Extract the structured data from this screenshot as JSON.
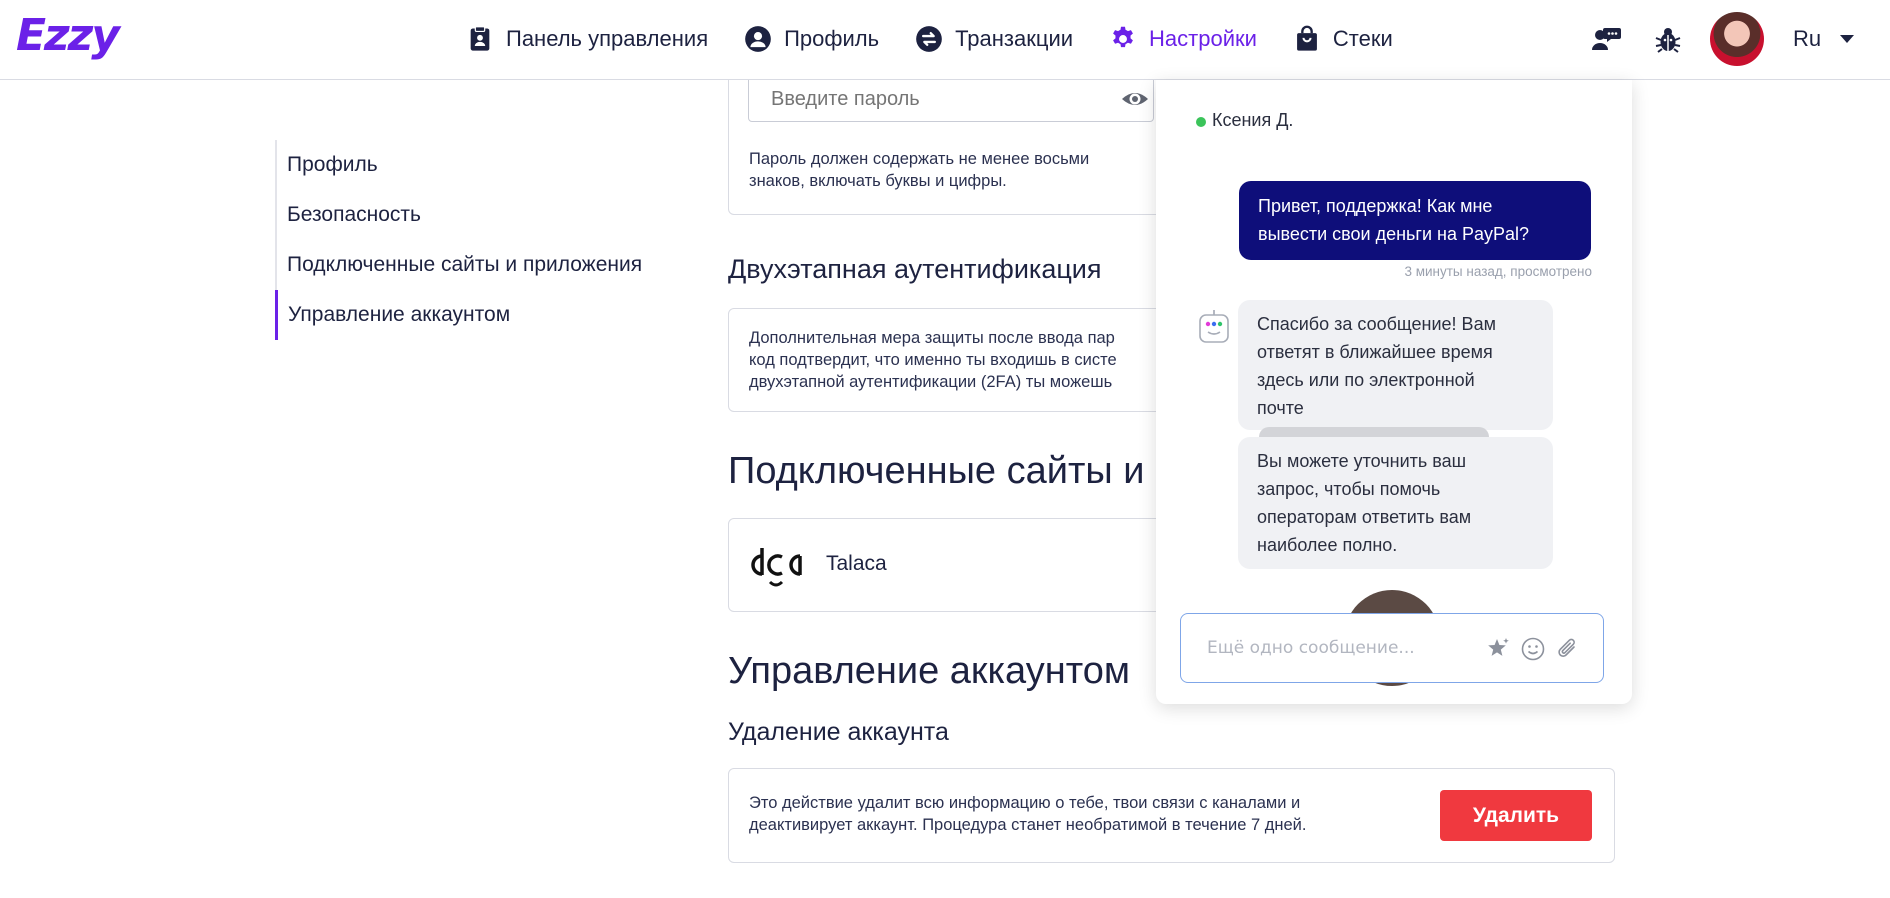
{
  "header": {
    "logo": "Ezzy",
    "nav": [
      {
        "label": "Панель управления",
        "icon": "clipboard-icon"
      },
      {
        "label": "Профиль",
        "icon": "user-circle-icon"
      },
      {
        "label": "Транзакции",
        "icon": "exchange-icon"
      },
      {
        "label": "Настройки",
        "icon": "gear-icon",
        "active": true
      },
      {
        "label": "Стеки",
        "icon": "shopping-bag-icon"
      }
    ],
    "language": "Ru",
    "colors": {
      "accent": "#6b21e8",
      "text": "#1d2240"
    }
  },
  "sidebar": {
    "items": [
      {
        "label": "Профиль"
      },
      {
        "label": "Безопасность"
      },
      {
        "label": "Подключенные сайты и приложения"
      },
      {
        "label": "Управление аккаунтом",
        "active": true
      }
    ]
  },
  "security": {
    "password_placeholder": "Введите пароль",
    "password_hint": "Пароль должен содержать не менее восьми знаков, включать буквы и цифры."
  },
  "two_factor": {
    "title": "Двухэтапная аутентификация",
    "lines": [
      "Дополнительная мера защиты после ввода пар",
      "код подтвердит, что именно ты входишь в систе",
      "двухэтапной аутентификации (2FA) ты можешь"
    ]
  },
  "connected": {
    "title": "Подключенные сайты и",
    "apps": [
      {
        "name": "Talaca"
      }
    ]
  },
  "account": {
    "title": "Управление аккаунтом",
    "delete_title": "Удаление аккаунта",
    "delete_lines": [
      "Это действие удалит всю информацию о тебе, твои связи с каналами и",
      "деактивирует аккаунт. Процедура станет необратимой в течение 7 дней."
    ],
    "delete_button": "Удалить",
    "delete_color": "#f0393f"
  },
  "chat": {
    "agent_name": "Ксения Д.",
    "user_message_lines": [
      "Привет, поддержка! Как мне",
      "вывести свои деньги на PayPal?"
    ],
    "meta": "3 минуты назад, просмотрено",
    "bot_message_1_lines": [
      "Спасибо за сообщение! Вам",
      "ответят в ближайшее время",
      "здесь или по электронной",
      "почте"
    ],
    "bot_message_2_lines": [
      "Вы можете уточнить ваш",
      "запрос, чтобы помочь",
      "операторам ответить вам",
      "наиболее полно."
    ],
    "input_placeholder": "Ещё одно сообщение...",
    "colors": {
      "user_bubble": "#0e0e7a",
      "bot_bubble": "#f0f1f4",
      "online": "#3bc45a"
    }
  }
}
